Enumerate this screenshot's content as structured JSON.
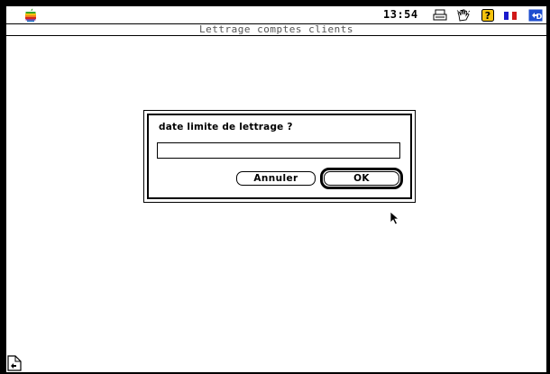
{
  "menubar": {
    "clock": "13:54",
    "icons": [
      "apple-icon",
      "printer-icon",
      "hand-icon",
      "help-icon",
      "flag-icon",
      "app-icon"
    ]
  },
  "window": {
    "title": "Lettrage comptes clients"
  },
  "dialog": {
    "prompt": "date limite de lettrage ?",
    "input_value": "",
    "cancel_label": "Annuler",
    "ok_label": "OK"
  },
  "colors": {
    "frame": "#000000",
    "background": "#ffffff",
    "flag_blue": "#1a1acc",
    "flag_red": "#d01818",
    "apple_green": "#3aa52a",
    "apple_yellow": "#f4c20d",
    "apple_orange": "#f2801e",
    "apple_red": "#d4261c",
    "apple_purple": "#8a3a9a",
    "apple_blue": "#1e78c8"
  }
}
